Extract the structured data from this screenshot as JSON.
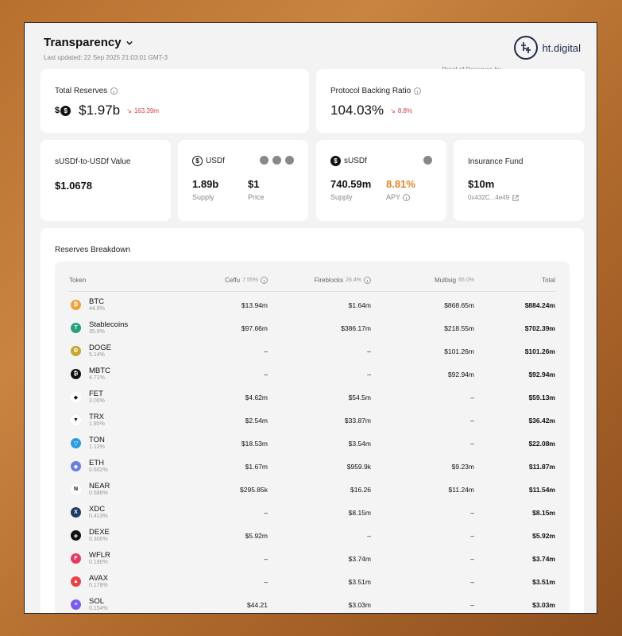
{
  "header": {
    "title": "Transparency",
    "updated": "Last updated: 22 Sep 2025 21:03:01 GMT-3",
    "proof": "Proof of Reserves by",
    "brand": "ht.digital"
  },
  "cards": {
    "total_reserves": {
      "label": "Total Reserves",
      "value": "$1.97b",
      "change": "163.39m"
    },
    "backing_ratio": {
      "label": "Protocol Backing Ratio",
      "value": "104.03%",
      "change": "8.8%"
    },
    "susdf_value": {
      "label": "sUSDf-to-USDf Value",
      "value": "$1.0678"
    },
    "usdf": {
      "label": "USDf",
      "supply": "1.89b",
      "supply_label": "Supply",
      "price": "$1",
      "price_label": "Price"
    },
    "susdf": {
      "label": "sUSDf",
      "supply": "740.59m",
      "supply_label": "Supply",
      "apy": "8.81%",
      "apy_label": "APY"
    },
    "insurance": {
      "label": "Insurance Fund",
      "value": "$10m",
      "address": "0x432C...4e49"
    }
  },
  "breakdown": {
    "title": "Reserves Breakdown",
    "columns": {
      "token": "Token",
      "ceffu": "Ceffu",
      "ceffu_pct": "7.55%",
      "fireblocks": "Fireblocks",
      "fireblocks_pct": "26.4%",
      "multisig": "Multisig",
      "multisig_pct": "66.0%",
      "total": "Total"
    },
    "rows": [
      {
        "name": "BTC",
        "pct": "44.8%",
        "ceffu": "$13.94m",
        "fireblocks": "$1.64m",
        "multisig": "$868.65m",
        "total": "$884.24m",
        "color": "#f2a13a",
        "glyph": "₿"
      },
      {
        "name": "Stablecoins",
        "pct": "35.6%",
        "ceffu": "$97.66m",
        "fireblocks": "$386.17m",
        "multisig": "$218.55m",
        "total": "$702.39m",
        "color": "#26a17b",
        "glyph": "T"
      },
      {
        "name": "DOGE",
        "pct": "5.14%",
        "ceffu": "–",
        "fireblocks": "–",
        "multisig": "$101.26m",
        "total": "$101.26m",
        "color": "#c8a633",
        "glyph": "Đ"
      },
      {
        "name": "MBTC",
        "pct": "4.71%",
        "ceffu": "–",
        "fireblocks": "–",
        "multisig": "$92.94m",
        "total": "$92.94m",
        "color": "#111111",
        "glyph": "₿"
      },
      {
        "name": "FET",
        "pct": "3.00%",
        "ceffu": "$4.62m",
        "fireblocks": "$54.5m",
        "multisig": "–",
        "total": "$59.13m",
        "color": "#ffffff",
        "glyph": "◆"
      },
      {
        "name": "TRX",
        "pct": "1.85%",
        "ceffu": "$2.54m",
        "fireblocks": "$33.87m",
        "multisig": "–",
        "total": "$36.42m",
        "color": "#ffffff",
        "glyph": "▼"
      },
      {
        "name": "TON",
        "pct": "1.12%",
        "ceffu": "$18.53m",
        "fireblocks": "$3.54m",
        "multisig": "–",
        "total": "$22.08m",
        "color": "#2a9be0",
        "glyph": "▽"
      },
      {
        "name": "ETH",
        "pct": "0.602%",
        "ceffu": "$1.67m",
        "fireblocks": "$959.9k",
        "multisig": "$9.23m",
        "total": "$11.87m",
        "color": "#6a7fd8",
        "glyph": "◆"
      },
      {
        "name": "NEAR",
        "pct": "0.586%",
        "ceffu": "$295.85k",
        "fireblocks": "$16.26",
        "multisig": "$11.24m",
        "total": "$11.54m",
        "color": "#ffffff",
        "glyph": "N"
      },
      {
        "name": "XDC",
        "pct": "0.413%",
        "ceffu": "–",
        "fireblocks": "$8.15m",
        "multisig": "–",
        "total": "$8.15m",
        "color": "#1f3a66",
        "glyph": "X"
      },
      {
        "name": "DEXE",
        "pct": "0.300%",
        "ceffu": "$5.92m",
        "fireblocks": "–",
        "multisig": "–",
        "total": "$5.92m",
        "color": "#111111",
        "glyph": "◈"
      },
      {
        "name": "WFLR",
        "pct": "0.190%",
        "ceffu": "–",
        "fireblocks": "$3.74m",
        "multisig": "–",
        "total": "$3.74m",
        "color": "#e23a63",
        "glyph": "F"
      },
      {
        "name": "AVAX",
        "pct": "0.178%",
        "ceffu": "–",
        "fireblocks": "$3.51m",
        "multisig": "–",
        "total": "$3.51m",
        "color": "#e84142",
        "glyph": "▲"
      },
      {
        "name": "SOL",
        "pct": "0.154%",
        "ceffu": "$44.21",
        "fireblocks": "$3.03m",
        "multisig": "–",
        "total": "$3.03m",
        "color": "#7a5cf0",
        "glyph": "≡"
      }
    ]
  }
}
